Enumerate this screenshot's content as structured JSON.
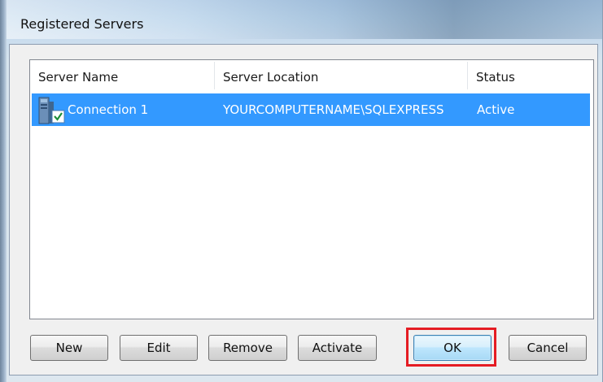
{
  "window": {
    "title": "Registered Servers"
  },
  "list": {
    "columns": [
      "Server Name",
      "Server Location",
      "Status"
    ],
    "rows": [
      {
        "name": "Connection 1",
        "location": "YOURCOMPUTERNAME\\SQLEXPRESS",
        "status": "Active",
        "selected": true,
        "icon": "server-connection-icon"
      }
    ]
  },
  "buttons": {
    "new": "New",
    "edit": "Edit",
    "remove": "Remove",
    "activate": "Activate",
    "ok": "OK",
    "cancel": "Cancel"
  },
  "colors": {
    "selection": "#3399ff",
    "highlight_box": "#e51c23"
  }
}
